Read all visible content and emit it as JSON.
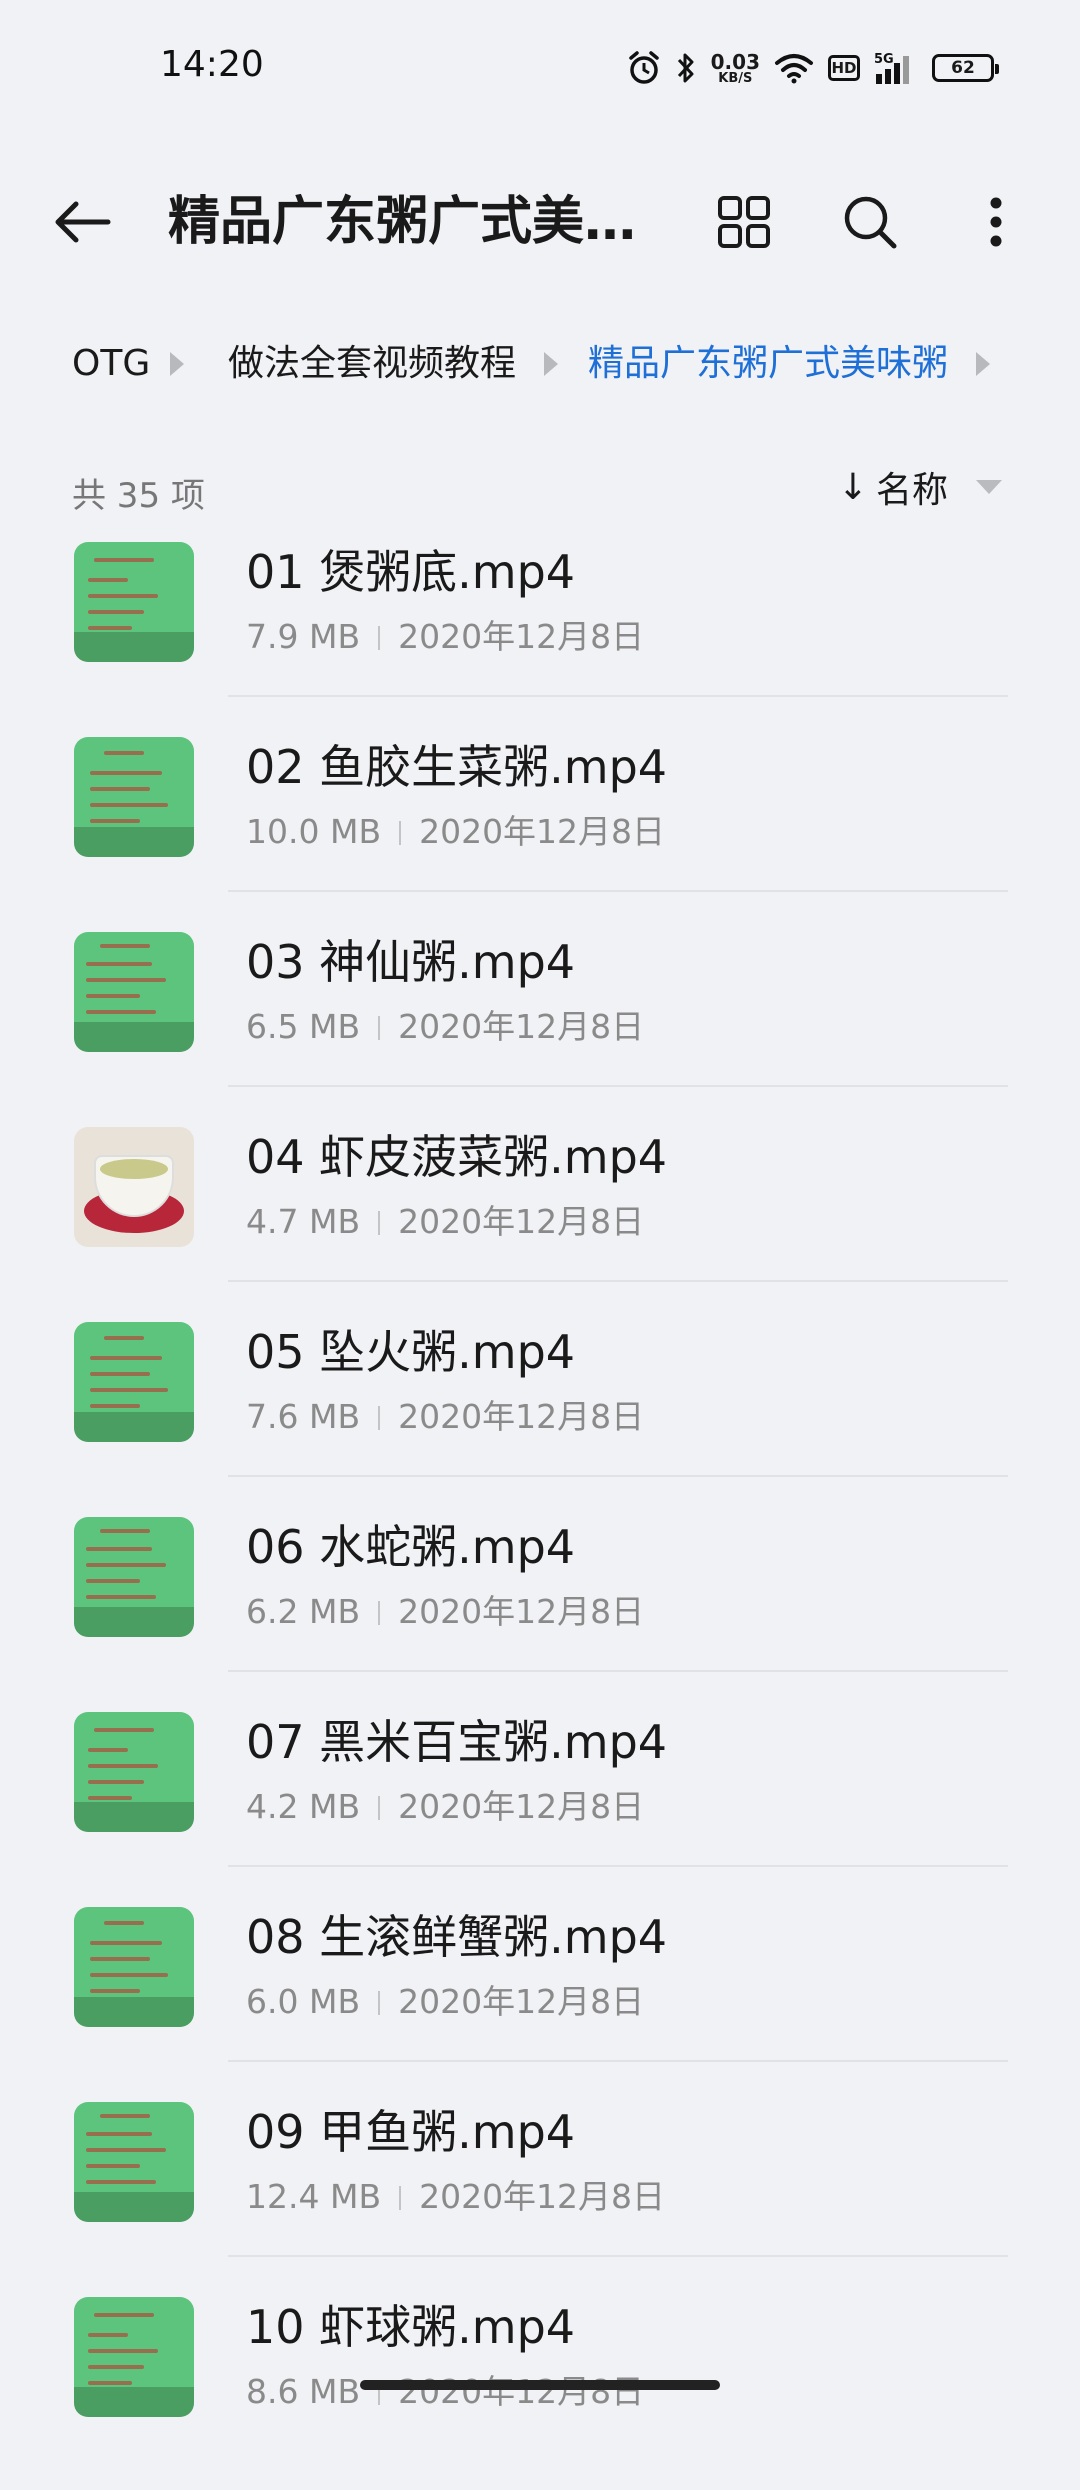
{
  "status_bar": {
    "time": "14:20",
    "net_speed_value": "0.03",
    "net_speed_unit": "KB/S",
    "hd_label": "HD",
    "network_type": "5G",
    "battery_level": "62",
    "icons": [
      "alarm-icon",
      "bluetooth-icon",
      "wifi-icon",
      "signal-icon",
      "battery-icon"
    ]
  },
  "app_bar": {
    "title": "精品广东粥广式美…",
    "icons": [
      "back-arrow-icon",
      "grid-view-icon",
      "search-icon",
      "more-vert-icon"
    ]
  },
  "breadcrumb": {
    "items": [
      {
        "label": "OTG",
        "active": false
      },
      {
        "label": "做法全套视频教程",
        "active": false
      },
      {
        "label": "精品广东粥广式美味粥",
        "active": true
      }
    ]
  },
  "summary": {
    "count_label": "共 35 项"
  },
  "sort": {
    "label": "名称",
    "direction_icon": "arrow-down-icon"
  },
  "colors": {
    "accent": "#1e6fd6",
    "background": "#f1f2f5",
    "thumb_green": "#5cc47d"
  },
  "files": [
    {
      "name": "01 煲粥底.mp4",
      "size": "7.9 MB",
      "date": "2020年12月8日",
      "thumb": "green-video-thumbnail"
    },
    {
      "name": "02 鱼胶生菜粥.mp4",
      "size": "10.0 MB",
      "date": "2020年12月8日",
      "thumb": "green-video-thumbnail"
    },
    {
      "name": "03 神仙粥.mp4",
      "size": "6.5 MB",
      "date": "2020年12月8日",
      "thumb": "green-video-thumbnail"
    },
    {
      "name": "04 虾皮菠菜粥.mp4",
      "size": "4.7 MB",
      "date": "2020年12月8日",
      "thumb": "porridge-bowl-thumbnail"
    },
    {
      "name": "05 坠火粥.mp4",
      "size": "7.6 MB",
      "date": "2020年12月8日",
      "thumb": "green-video-thumbnail"
    },
    {
      "name": "06 水蛇粥.mp4",
      "size": "6.2 MB",
      "date": "2020年12月8日",
      "thumb": "green-video-thumbnail"
    },
    {
      "name": "07 黑米百宝粥.mp4",
      "size": "4.2 MB",
      "date": "2020年12月8日",
      "thumb": "green-video-thumbnail"
    },
    {
      "name": "08 生滚鲜蟹粥.mp4",
      "size": "6.0 MB",
      "date": "2020年12月8日",
      "thumb": "green-video-thumbnail"
    },
    {
      "name": "09 甲鱼粥.mp4",
      "size": "12.4 MB",
      "date": "2020年12月8日",
      "thumb": "green-video-thumbnail"
    },
    {
      "name": "10 虾球粥.mp4",
      "size": "8.6 MB",
      "date": "2020年12月8日",
      "thumb": "green-video-thumbnail"
    }
  ]
}
